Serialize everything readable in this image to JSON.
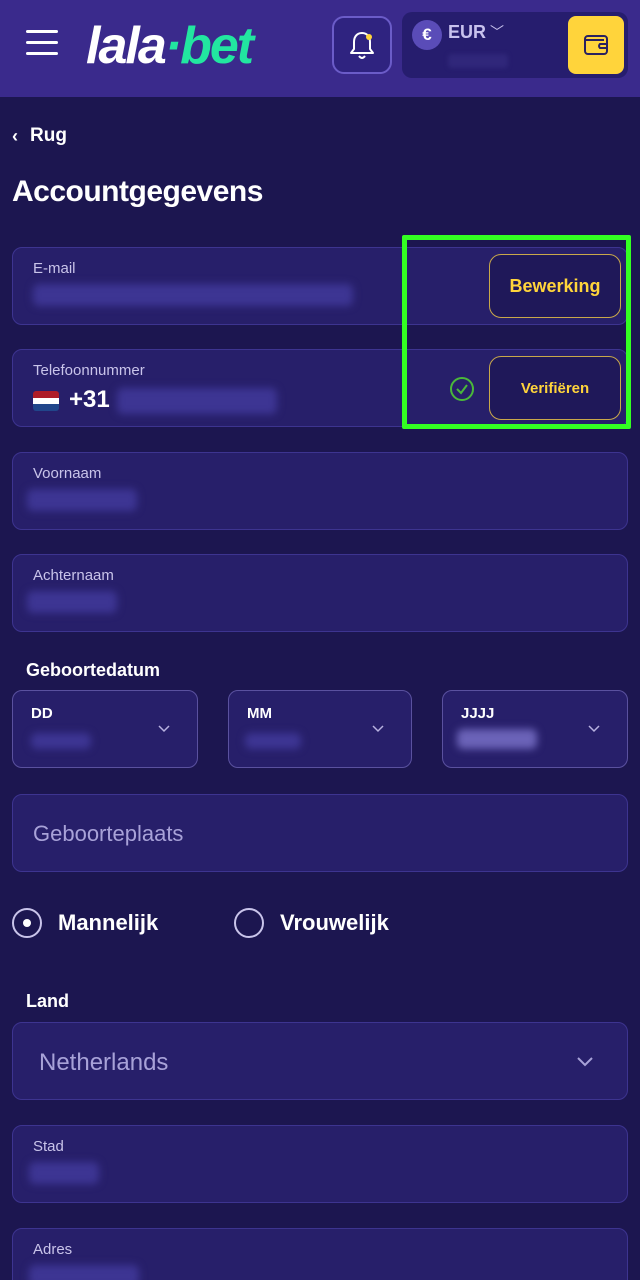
{
  "header": {
    "logo_left": "lala",
    "logo_dot": "·",
    "logo_right": "bet",
    "currency_symbol": "€",
    "currency": "EUR"
  },
  "back_label": "Rug",
  "page_title": "Accountgegevens",
  "fields": {
    "email_label": "E-mail",
    "edit_button": "Bewerking",
    "phone_label": "Telefoonnummer",
    "phone_prefix": "+31",
    "verify_button": "Verifiëren",
    "first_name_label": "Voornaam",
    "last_name_label": "Achternaam"
  },
  "birthdate": {
    "label": "Geboortedatum",
    "day": "DD",
    "month": "MM",
    "year": "JJJJ"
  },
  "birthplace_placeholder": "Geboorteplaats",
  "gender": {
    "male": "Mannelijk",
    "female": "Vrouwelijk",
    "selected": "male"
  },
  "country": {
    "label": "Land",
    "value": "Netherlands"
  },
  "city_label": "Stad",
  "address_label": "Adres",
  "colors": {
    "background": "#1c1650",
    "header": "#3a2a8c",
    "accent_green": "#22e6a0",
    "accent_yellow": "#ffd43b",
    "highlight": "#33ff22"
  }
}
